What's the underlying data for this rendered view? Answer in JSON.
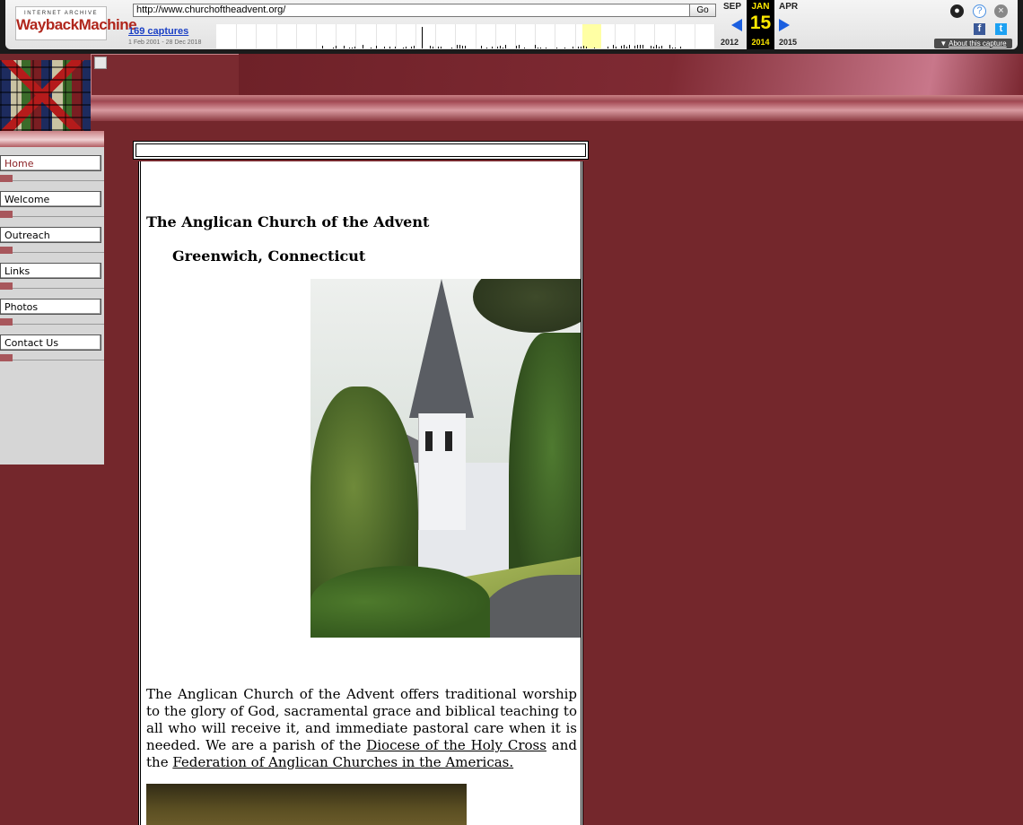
{
  "wayback": {
    "logo_line1": "INTERNET ARCHIVE",
    "logo_line2": "WaybackMachine",
    "url": "http://www.churchoftheadvent.org/",
    "go_label": "Go",
    "captures": "169 captures",
    "range": "1 Feb 2001 - 28 Dec 2018",
    "prev_month": "SEP",
    "current_month": "JAN",
    "next_month": "APR",
    "current_day": "15",
    "prev_year": "2012",
    "current_year": "2014",
    "next_year": "2015",
    "about": "About this capture",
    "icons": [
      "user-icon",
      "help-icon",
      "close-icon",
      "facebook-icon",
      "twitter-icon"
    ]
  },
  "nav": {
    "items": [
      {
        "label": "Home",
        "active": true
      },
      {
        "label": "Welcome"
      },
      {
        "label": "Outreach"
      },
      {
        "label": "Links"
      },
      {
        "label": "Photos"
      },
      {
        "label": "Contact Us"
      }
    ]
  },
  "content": {
    "title": "The Anglican Church of the Advent",
    "subtitle": "Greenwich, Connecticut",
    "para_before_link1": "The Anglican Church of the Advent offers traditional worship to the glory of God, sacramental grace and biblical teaching to all who will receive it, and immediate pastoral care when it is needed. We are a parish of the ",
    "link1": "Diocese of the Holy Cross",
    "para_between": " and the ",
    "link2": " Federation of Anglican Churches in the Americas."
  },
  "colors": {
    "page_bg": "#74272c",
    "accent_red": "#8b2226",
    "wayback_blue": "#1b5fe0",
    "wayback_yellow": "#ffe900"
  }
}
